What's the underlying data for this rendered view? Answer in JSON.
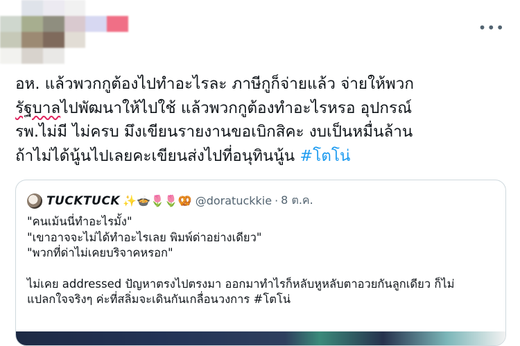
{
  "tweet": {
    "more_label": "•••",
    "lines": [
      "อห. แล้วพวกกูต้องไปทำอะไรละ ภาษีกูก็จ่ายแล้ว จ่ายให้พวก",
      "ไปพัฒนาให้ไปใช้ แล้วพวกกูต้องทำอะไรหรอ อุปกรณ์",
      "รพ.ไม่มี ไม่ครบ มึงเขียนรายงานขอเบิกสิคะ งบเป็นหมื่นล้าน",
      "ถ้าไม่ได้นู้นไปเลยคะเขียนส่งไปที่อนุทินนู้น"
    ],
    "misspelled_word": "รัฐบาล",
    "hashtag": "#โตโน่"
  },
  "quote": {
    "name": "TUCKTUCK",
    "emoji": "✨🍲🌷🌷🥨",
    "handle": "@doratuckkie",
    "separator": "·",
    "time": "8 ต.ค.",
    "lines": [
      "\"คนเม้นนี่ทำอะไรมั้ง\"",
      "\"เขาอาจจะไม่ได้ทำอะไรเลย พิมพ์ด่าอย่างเดียว\"",
      "\"พวกที่ด่าไม่เคยบริจาคหรอก\"",
      "ไม่เคย addressed ปัญหาตรงไปตรงมา ออกมาทำไรก็หลับหูหลับตาอวยกันลูกเดียว ก็ไม่",
      "แปลกใจจริงๆ ค่ะที่สลิ่มจะเดินกันเกลื่อนวงการ #โตโน่"
    ]
  },
  "colors": {
    "accent": "#1d9bf0",
    "secondary_text": "#536471",
    "border": "#cfd9de",
    "spellcheck": "#e0245e"
  }
}
